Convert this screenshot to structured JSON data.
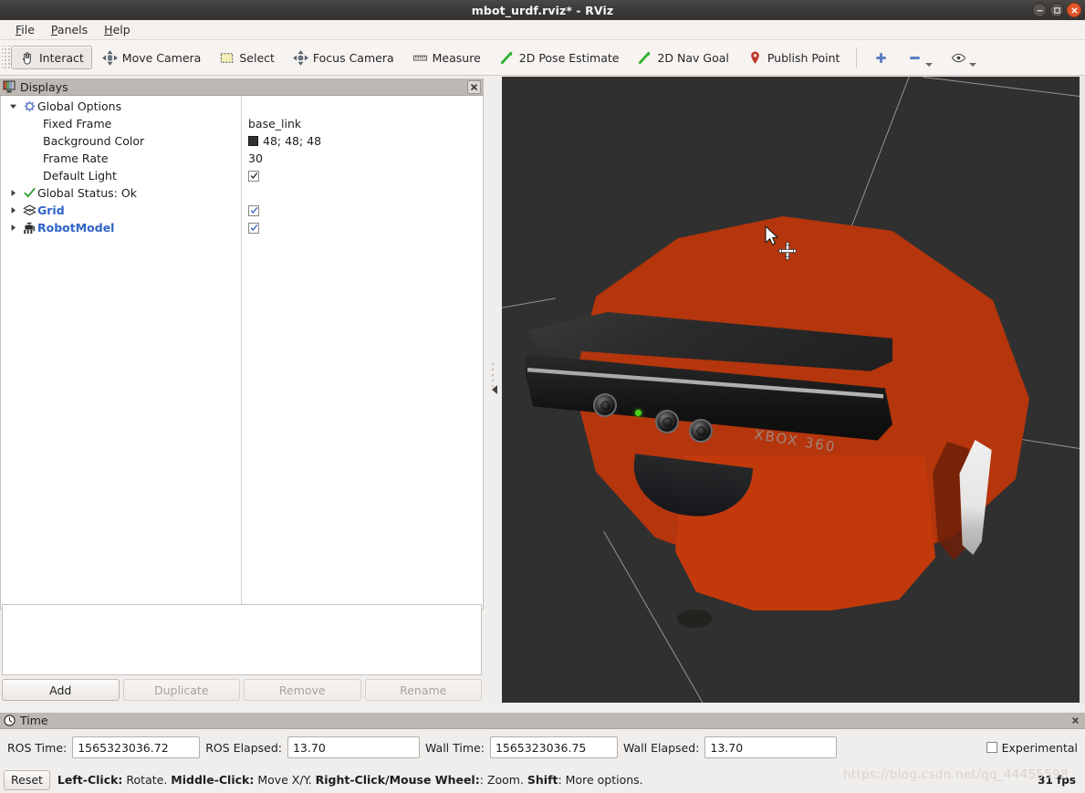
{
  "window": {
    "title": "mbot_urdf.rviz* - RViz",
    "controls": [
      "minimize-button",
      "maximize-button",
      "close-button"
    ]
  },
  "menubar": {
    "items": [
      {
        "label": "File",
        "mnemonic": "F"
      },
      {
        "label": "Panels",
        "mnemonic": "P"
      },
      {
        "label": "Help",
        "mnemonic": "H"
      }
    ]
  },
  "toolbar": {
    "buttons": [
      {
        "label": "Interact",
        "icon": "hand-cursor-icon",
        "active": true
      },
      {
        "label": "Move Camera",
        "icon": "move-camera-icon",
        "active": false
      },
      {
        "label": "Select",
        "icon": "select-rectangle-icon",
        "active": false
      },
      {
        "label": "Focus Camera",
        "icon": "focus-camera-icon",
        "active": false
      },
      {
        "label": "Measure",
        "icon": "ruler-icon",
        "active": false
      },
      {
        "label": "2D Pose Estimate",
        "icon": "green-arrow-icon",
        "active": false
      },
      {
        "label": "2D Nav Goal",
        "icon": "green-arrow-icon",
        "active": false
      },
      {
        "label": "Publish Point",
        "icon": "map-pin-icon",
        "active": false
      }
    ],
    "extras": [
      {
        "icon": "plus-icon",
        "name": "add-tool-button"
      },
      {
        "icon": "minus-icon",
        "name": "remove-tool-button"
      },
      {
        "icon": "eye-icon",
        "name": "view-button"
      }
    ]
  },
  "displays": {
    "panel_title": "Displays",
    "tree": [
      {
        "label": "Global Options",
        "icon": "gear-icon",
        "expanded": true,
        "has_twisty": true,
        "indent": 0,
        "value_type": "none",
        "value": "",
        "bold": false
      },
      {
        "label": "Fixed Frame",
        "icon": "",
        "has_twisty": false,
        "indent": 1,
        "value_type": "text",
        "value": "base_link",
        "bold": false
      },
      {
        "label": "Background Color",
        "icon": "",
        "has_twisty": false,
        "indent": 1,
        "value_type": "color",
        "value": "48; 48; 48",
        "swatch": "#303030",
        "bold": false
      },
      {
        "label": "Frame Rate",
        "icon": "",
        "has_twisty": false,
        "indent": 1,
        "value_type": "text",
        "value": "30",
        "bold": false
      },
      {
        "label": "Default Light",
        "icon": "",
        "has_twisty": false,
        "indent": 1,
        "value_type": "checkbox",
        "value": "checked",
        "bold": false
      },
      {
        "label": "Global Status: Ok",
        "icon": "green-check-icon",
        "has_twisty": true,
        "expanded": false,
        "indent": 0,
        "value_type": "none",
        "value": "",
        "bold": false
      },
      {
        "label": "Grid",
        "icon": "grid-icon",
        "has_twisty": true,
        "expanded": false,
        "indent": 0,
        "value_type": "checkbox",
        "value": "checked",
        "bold": true
      },
      {
        "label": "RobotModel",
        "icon": "robot-icon",
        "has_twisty": true,
        "expanded": false,
        "indent": 0,
        "value_type": "checkbox",
        "value": "checked",
        "bold": true
      }
    ],
    "buttons": [
      {
        "label": "Add",
        "enabled": true
      },
      {
        "label": "Duplicate",
        "enabled": false
      },
      {
        "label": "Remove",
        "enabled": false
      },
      {
        "label": "Rename",
        "enabled": false
      }
    ]
  },
  "viewport": {
    "background_color": "#303030",
    "robot_color": "#b5350c",
    "sensor_label": "XBOX 360",
    "cursor": "arrow-cursor",
    "interactive_marker": "move-crosshair-icon"
  },
  "time": {
    "panel_title": "Time",
    "fields": [
      {
        "label": "ROS Time:",
        "value": "1565323036.72"
      },
      {
        "label": "ROS Elapsed:",
        "value": "13.70"
      },
      {
        "label": "Wall Time:",
        "value": "1565323036.75"
      },
      {
        "label": "Wall Elapsed:",
        "value": "13.70"
      }
    ],
    "experimental": {
      "label": "Experimental",
      "checked": false
    }
  },
  "statusbar": {
    "reset_label": "Reset",
    "hint_parts": [
      {
        "text": "Left-Click:",
        "bold": true
      },
      {
        "text": " Rotate. ",
        "bold": false
      },
      {
        "text": "Middle-Click:",
        "bold": true
      },
      {
        "text": " Move X/Y. ",
        "bold": false
      },
      {
        "text": "Right-Click/Mouse Wheel:",
        "bold": true
      },
      {
        "text": ": Zoom. ",
        "bold": false
      },
      {
        "text": "Shift",
        "bold": true
      },
      {
        "text": ": More options.",
        "bold": false
      }
    ],
    "fps": "31 fps",
    "watermark": "https://blog.csdn.net/qq_44455598"
  }
}
